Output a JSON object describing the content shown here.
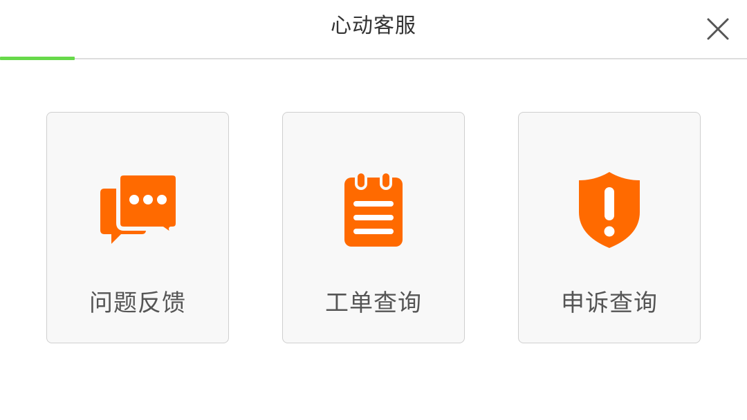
{
  "header": {
    "title": "心动客服",
    "close_icon": "close-icon"
  },
  "colors": {
    "accent_orange": "#ff6a00",
    "progress_green": "#67d94a"
  },
  "options": [
    {
      "label": "问题反馈",
      "icon": "chat-bubbles-icon"
    },
    {
      "label": "工单查询",
      "icon": "notepad-icon"
    },
    {
      "label": "申诉查询",
      "icon": "shield-alert-icon"
    }
  ]
}
